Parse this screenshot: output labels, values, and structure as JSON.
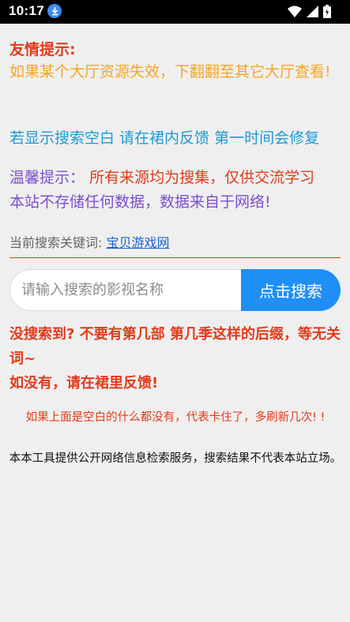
{
  "status_bar": {
    "time": "10:17",
    "icons": [
      "download-icon",
      "wifi-icon",
      "signal-icon",
      "battery-icon"
    ]
  },
  "tip": {
    "title": "友情提示:",
    "body": "如果某个大厅资源失效，下翻翻至其它大厅查看!"
  },
  "notice1": "若显示搜索空白 请在裙内反馈 第一时间会修复",
  "notice2": {
    "prefix": "温馨提示：",
    "highlight": "所有来源均为搜集，仅供交流学习",
    "rest": "本站不存储任何数据，数据来自于网络!"
  },
  "keyword": {
    "label": "当前搜索关键词: ",
    "value": "宝贝游戏网"
  },
  "search": {
    "placeholder": "请输入搜索的影视名称",
    "value": "",
    "button_label": "点击搜索"
  },
  "warning": {
    "line1": "没搜索到? 不要有第几部 第几季这样的后缀，等无关词~",
    "line2": "如没有，请在裙里反馈!"
  },
  "footer": {
    "red_note": "如果上面是空白的什么都没有，代表卡住了，多刷新几次! !",
    "disclaimer": "本本工具提供公开网络信息检索服务，搜索结果不代表本站立场。"
  },
  "colors": {
    "title_red": "#e23b1b",
    "tip_orange": "#f5a623",
    "notice_blue": "#1e9ad6",
    "notice_purple": "#7b4fcf",
    "button_blue": "#1f8ff5",
    "background": "#efefef"
  }
}
